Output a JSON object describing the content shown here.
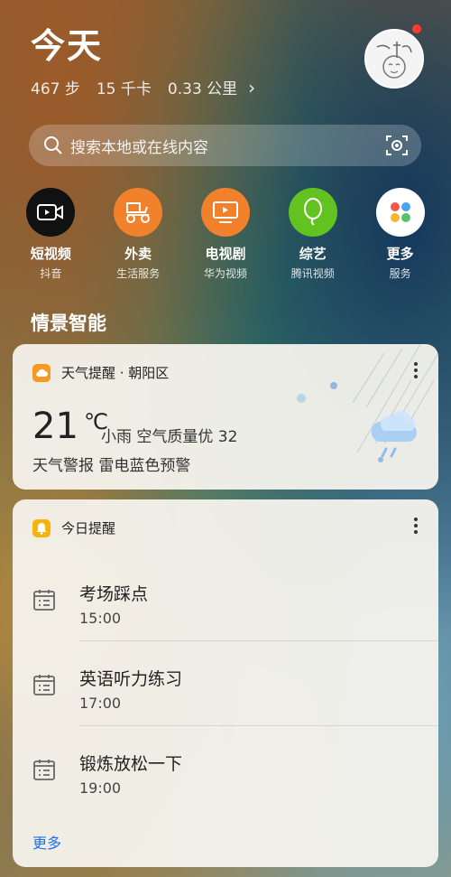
{
  "header": {
    "title": "今天",
    "steps": "467 步",
    "calories": "15 千卡",
    "distance": "0.33 公里",
    "chevron": "›"
  },
  "search": {
    "placeholder": "搜索本地或在线内容"
  },
  "apps": [
    {
      "label": "短视频",
      "sub": "抖音",
      "icon": "video-icon",
      "color": "#111111"
    },
    {
      "label": "外卖",
      "sub": "生活服务",
      "icon": "scooter-icon",
      "color": "#f2812b"
    },
    {
      "label": "电视剧",
      "sub": "华为视频",
      "icon": "tv-icon",
      "color": "#f2812b"
    },
    {
      "label": "综艺",
      "sub": "腾讯视频",
      "icon": "balloon-icon",
      "color": "#62c21f"
    },
    {
      "label": "更多",
      "sub": "服务",
      "icon": "grid-icon",
      "color": "#ffffff"
    }
  ],
  "section_title": "情景智能",
  "weather_card": {
    "title": "天气提醒 · 朝阳区",
    "temperature": "21",
    "unit": "℃",
    "description": "小雨  空气质量优  32",
    "alert": "天气警报 雷电蓝色预警"
  },
  "reminder_card": {
    "title": "今日提醒",
    "items": [
      {
        "name": "考场踩点",
        "time": "15:00"
      },
      {
        "name": "英语听力练习",
        "time": "17:00"
      },
      {
        "name": "锻炼放松一下",
        "time": "19:00"
      }
    ],
    "more_label": "更多"
  }
}
